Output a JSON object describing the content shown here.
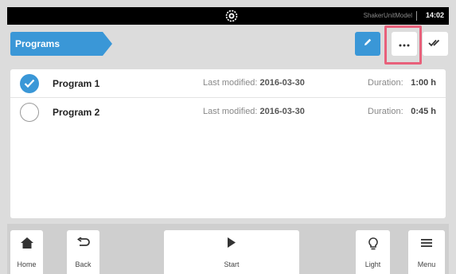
{
  "status_bar": {
    "logo_icon": "gear-logo-icon",
    "model": "ShakerUnitModel",
    "time": "14:02"
  },
  "header": {
    "breadcrumb": "Programs",
    "accent_color": "#3a97d7",
    "actions": [
      {
        "name": "edit",
        "icon": "pencil-icon"
      },
      {
        "name": "more",
        "icon": "ellipsis-icon"
      },
      {
        "name": "select",
        "icon": "double-check-icon"
      }
    ],
    "highlight_color": "#e8607a"
  },
  "programs": [
    {
      "name": "Program 1",
      "modified_label": "Last modified:",
      "modified": "2016-03-30",
      "duration_label": "Duration:",
      "duration": "1:00 h",
      "selected": true
    },
    {
      "name": "Program 2",
      "modified_label": "Last modified:",
      "modified": "2016-03-30",
      "duration_label": "Duration:",
      "duration": "0:45 h",
      "selected": false
    }
  ],
  "bottom_bar": {
    "home": "Home",
    "back": "Back",
    "start": "Start",
    "light": "Light",
    "menu": "Menu"
  }
}
